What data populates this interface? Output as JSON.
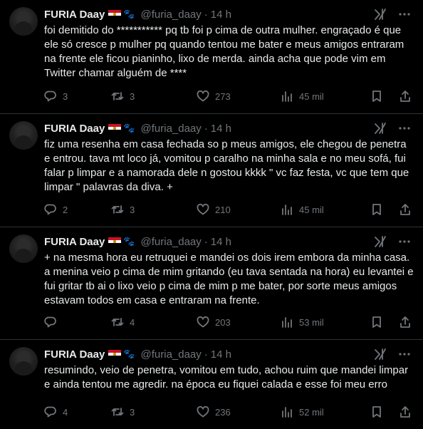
{
  "tweets": [
    {
      "name": "FURIA Daay",
      "handle": "@furia_daay",
      "time": "14 h",
      "text": "foi demitido do *********** pq tb foi p cima de outra mulher. engraçado é que ele só cresce p mulher pq quando tentou me bater e meus amigos entraram na frente ele ficou pianinho, lixo de merda. ainda acha que pode vim em Twitter chamar alguém de ****",
      "replies": "3",
      "reposts": "3",
      "likes": "273",
      "views": "45 mil"
    },
    {
      "name": "FURIA Daay",
      "handle": "@furia_daay",
      "time": "14 h",
      "text": "fiz uma resenha em casa fechada so p meus amigos, ele chegou de penetra e entrou. tava mt loco já, vomitou p caralho na minha sala e no meu sofá, fui falar p limpar e a namorada dele n gostou kkkk \" vc faz festa, vc que tem que limpar \" palavras da diva. +",
      "replies": "2",
      "reposts": "3",
      "likes": "210",
      "views": "45 mil"
    },
    {
      "name": "FURIA Daay",
      "handle": "@furia_daay",
      "time": "14 h",
      "text": "+ na mesma hora eu retruquei e mandei os dois irem embora da minha casa. a menina veio p cima de mim gritando (eu tava sentada na hora) eu levantei e fui gritar tb ai o lixo veio p cima de mim p me bater, por sorte meus amigos estavam todos em casa e entraram na frente.",
      "replies": "",
      "reposts": "4",
      "likes": "203",
      "views": "53 mil"
    },
    {
      "name": "FURIA Daay",
      "handle": "@furia_daay",
      "time": "14 h",
      "text": "resumindo, veio de penetra, vomitou em tudo, achou ruim que mandei limpar e ainda tentou me agredir. na época eu fiquei calada e esse foi meu erro",
      "replies": "4",
      "reposts": "3",
      "likes": "236",
      "views": "52 mil"
    }
  ],
  "icons": [
    "avatar",
    "flag-icon",
    "paw-icon",
    "grok-icon",
    "more-icon",
    "reply-icon",
    "repost-icon",
    "like-icon",
    "views-icon",
    "bookmark-icon",
    "share-icon"
  ],
  "colors": {
    "background": "#000000",
    "text": "#e7e9ea",
    "secondary": "#71767b",
    "divider": "#2f3336"
  }
}
